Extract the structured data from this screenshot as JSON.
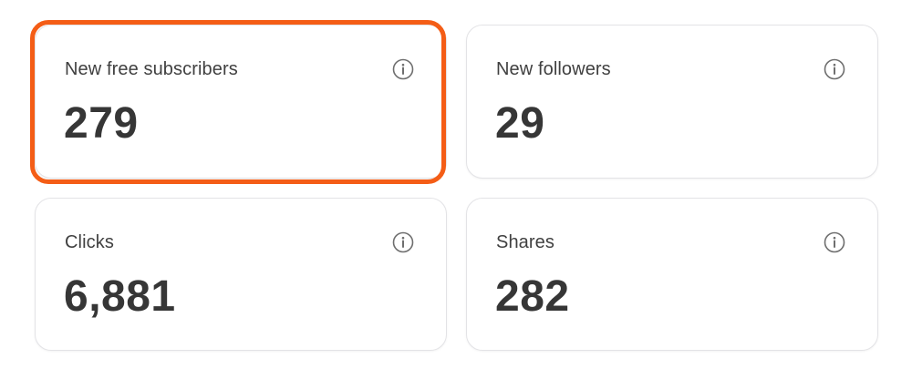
{
  "stats": [
    {
      "label": "New free subscribers",
      "value": "279",
      "icon": "info-icon"
    },
    {
      "label": "New followers",
      "value": "29",
      "icon": "info-icon"
    },
    {
      "label": "Clicks",
      "value": "6,881",
      "icon": "info-icon"
    },
    {
      "label": "Shares",
      "value": "282",
      "icon": "info-icon"
    }
  ],
  "colors": {
    "highlight": "#f45d16",
    "card_border": "#e3e3e6",
    "text_label": "#404040",
    "text_value": "#363636",
    "icon": "#6e6e6e"
  }
}
